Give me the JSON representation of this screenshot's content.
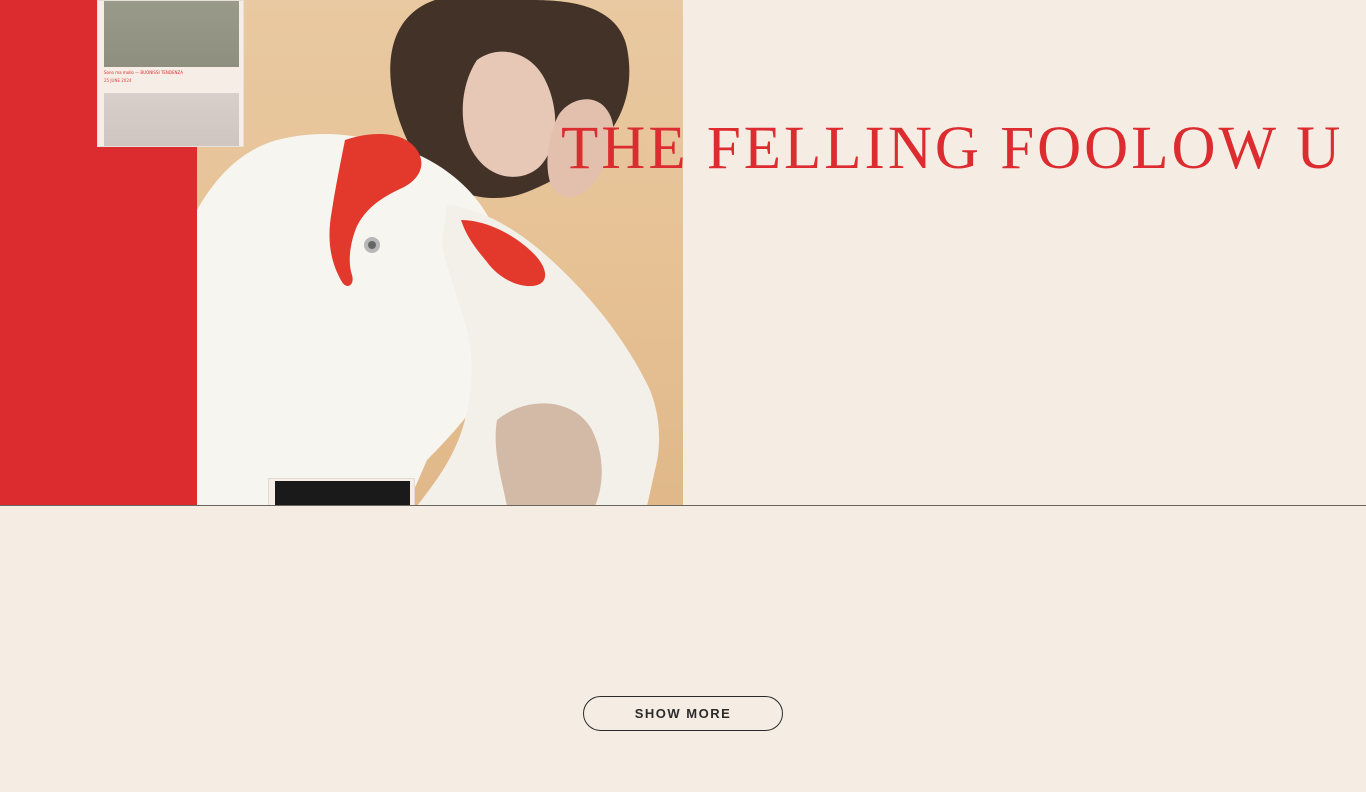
{
  "hero": {
    "headline": "THE FELLING FOOLOW U",
    "mini_card": {
      "caption": "Sono ma mollo — BUONISSI TENDENZA",
      "date": "25 JUNE 2024"
    }
  },
  "actions": {
    "show_more_label": "SHOW MORE"
  },
  "colors": {
    "accent_red": "#dc2c2f",
    "background": "#f5ece3",
    "text_dark": "#2b2b2b"
  }
}
